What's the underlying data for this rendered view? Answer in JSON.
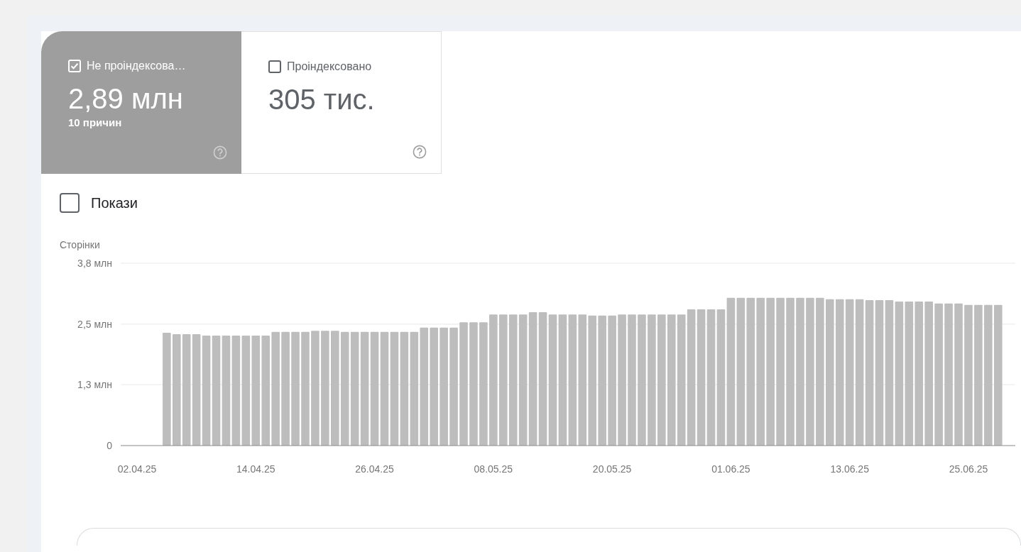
{
  "summary_cards": [
    {
      "label": "Не проіндексова…",
      "value": "2,89 млн",
      "subtitle": "10 причин",
      "selected": true,
      "checked": true
    },
    {
      "label": "Проіндексовано",
      "value": "305 тис.",
      "selected": false,
      "checked": false
    }
  ],
  "impressions_toggle": {
    "label": "Покази",
    "checked": false
  },
  "chart": {
    "chart_data": {
      "type": "bar",
      "ylabel": "Сторінки",
      "categories": [
        "02.04.25",
        null,
        null,
        null,
        null,
        null,
        null,
        null,
        null,
        null,
        null,
        null,
        "14.04.25",
        null,
        null,
        null,
        null,
        null,
        null,
        null,
        null,
        null,
        null,
        null,
        "26.04.25",
        null,
        null,
        null,
        null,
        null,
        null,
        null,
        null,
        null,
        null,
        null,
        "08.05.25",
        null,
        null,
        null,
        null,
        null,
        null,
        null,
        null,
        null,
        null,
        null,
        "20.05.25",
        null,
        null,
        null,
        null,
        null,
        null,
        null,
        null,
        null,
        null,
        null,
        "01.06.25",
        null,
        null,
        null,
        null,
        null,
        null,
        null,
        null,
        null,
        null,
        null,
        "13.06.25",
        null,
        null,
        null,
        null,
        null,
        null,
        null,
        null,
        null,
        null,
        null,
        "25.06.25",
        null,
        null,
        null
      ],
      "series": [
        {
          "color": "#bdbdbd",
          "values": [
            null,
            null,
            null,
            2.35,
            2.32,
            2.32,
            2.32,
            2.29,
            2.29,
            2.29,
            2.29,
            2.29,
            2.29,
            2.29,
            2.37,
            2.37,
            2.37,
            2.37,
            2.39,
            2.39,
            2.39,
            2.37,
            2.37,
            2.37,
            2.37,
            2.37,
            2.37,
            2.37,
            2.37,
            2.46,
            2.46,
            2.46,
            2.46,
            2.57,
            2.57,
            2.57,
            2.73,
            2.73,
            2.73,
            2.73,
            2.78,
            2.78,
            2.73,
            2.73,
            2.73,
            2.73,
            2.71,
            2.71,
            2.71,
            2.73,
            2.73,
            2.73,
            2.73,
            2.73,
            2.73,
            2.73,
            2.84,
            2.84,
            2.84,
            2.84,
            3.08,
            3.08,
            3.08,
            3.08,
            3.08,
            3.08,
            3.08,
            3.08,
            3.08,
            3.08,
            3.05,
            3.05,
            3.05,
            3.05,
            3.03,
            3.03,
            3.03,
            3.0,
            3.0,
            3.0,
            3.0,
            2.96,
            2.96,
            2.96,
            2.93,
            2.93,
            2.93,
            2.93
          ]
        }
      ],
      "ylim": [
        0,
        3.8
      ],
      "yticks": [
        0,
        {
          "value": 1.27,
          "label": "1,3 млн"
        },
        {
          "value": 2.53,
          "label": "2,5 млн"
        },
        {
          "value": 3.8,
          "label": "3,8 млн"
        }
      ]
    }
  }
}
